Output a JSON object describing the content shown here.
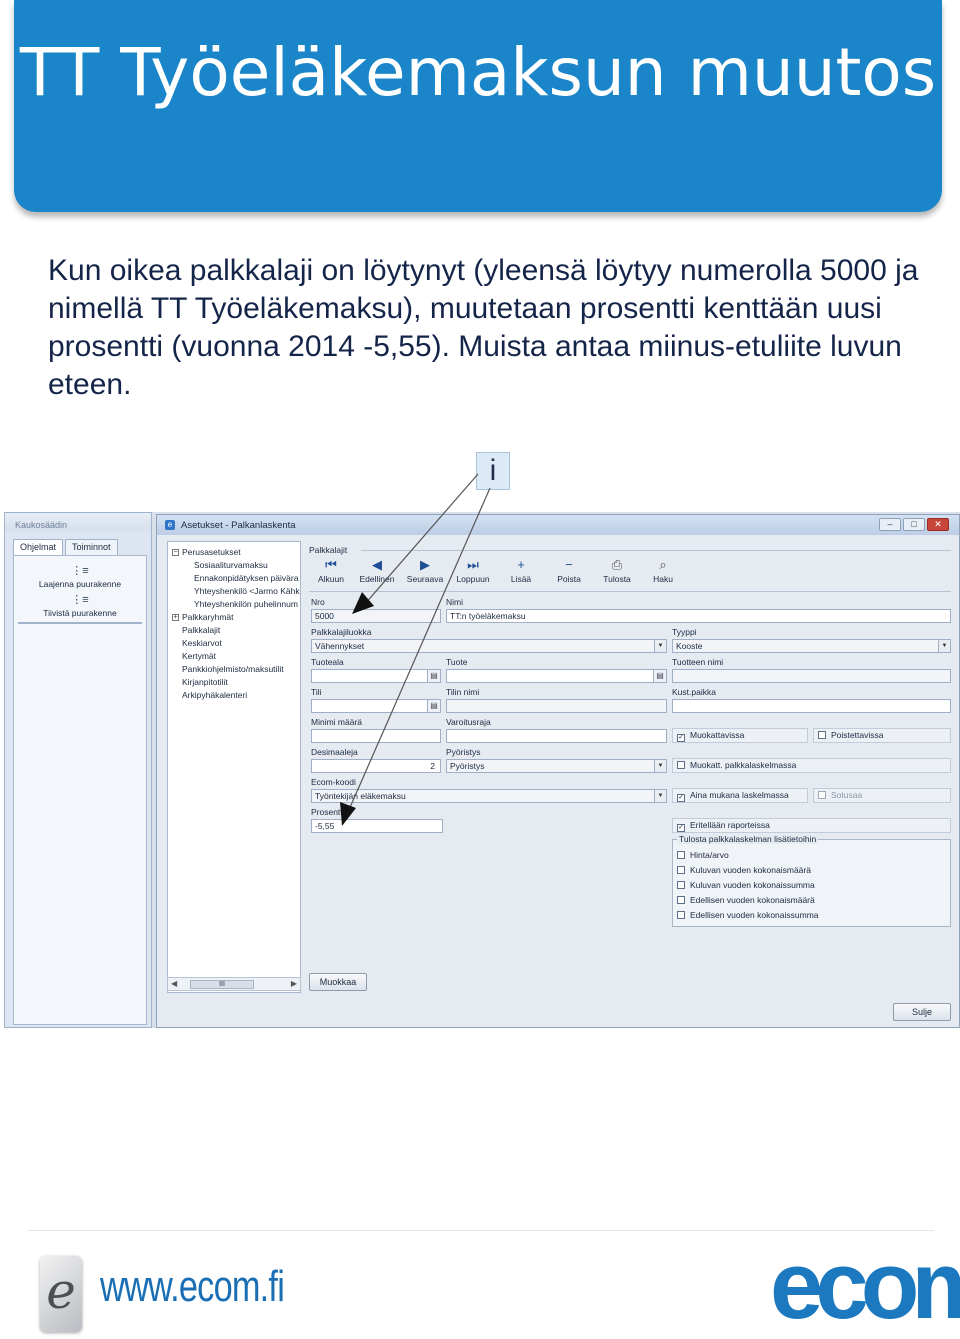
{
  "slide": {
    "title": "TT Työeläkemaksun muutos",
    "intro": "Kun oikea palkkalaji on löytynyt (yleensä löytyy numerolla 5000 ja nimellä TT Työeläkemaksu), muutetaan prosentti kenttään uusi prosentti (vuonna 2014 -5,55). Muista antaa miinus-etuliite luvun eteen.",
    "info_marker": "i",
    "footer_url": "www.ecom.fi",
    "footer_logo": "ecom",
    "footer_badge": "e",
    "accent_color": "#1a86c9"
  },
  "app": {
    "left_pane": {
      "title": "Kaukosäädin",
      "tabs": [
        "Ohjelmat",
        "Toiminnot"
      ],
      "items": [
        "Laajenna puurakenne",
        "Tiivistä puurakenne"
      ]
    },
    "window": {
      "title": "Asetukset - Palkanlaskenta",
      "controls": [
        "–",
        "□",
        "✕"
      ]
    },
    "tree": {
      "root": "Perusasetukset",
      "children": [
        "Sosiaaliturvamaksu",
        "Ennakonpidätyksen päivära",
        "Yhteyshenkilö <Jarmo Kähk",
        "Yhteyshenkilön puhelinnum"
      ],
      "items": [
        "Palkkaryhmät",
        "Palkkalajit",
        "Keskiarvot",
        "Kertymät",
        "Pankkiohjelmisto/maksutilit",
        "Kirjanpitotilit",
        "Arkipyhäkalenteri"
      ],
      "scroll_thumb": "III"
    },
    "buttons": {
      "edit": "Muokkaa",
      "close": "Sulje"
    },
    "toolbar": {
      "group_label": "Palkkalajit",
      "items": [
        {
          "label": "Alkuun",
          "icon": "first-icon",
          "glyph": "⏮"
        },
        {
          "label": "Edellinen",
          "icon": "previous-icon",
          "glyph": "◀"
        },
        {
          "label": "Seuraava",
          "icon": "next-icon",
          "glyph": "▶"
        },
        {
          "label": "Loppuun",
          "icon": "last-icon",
          "glyph": "⏭"
        },
        {
          "label": "Lisää",
          "icon": "add-icon",
          "glyph": "+"
        },
        {
          "label": "Poista",
          "icon": "remove-icon",
          "glyph": "−"
        },
        {
          "label": "Tulosta",
          "icon": "printer-icon",
          "glyph": "⎙"
        },
        {
          "label": "Haku",
          "icon": "search-icon",
          "glyph": "⌕"
        }
      ]
    },
    "form": {
      "nro": {
        "label": "Nro",
        "value": "5000"
      },
      "nimi": {
        "label": "Nimi",
        "value": "TT:n työeläkemaksu"
      },
      "palkkalajiluokka": {
        "label": "Palkkalajiluokka",
        "value": "Vähennykset"
      },
      "tyyppi": {
        "label": "Tyyppi",
        "value": "Kooste"
      },
      "tuoteala": {
        "label": "Tuoteala",
        "value": ""
      },
      "tuote": {
        "label": "Tuote",
        "value": ""
      },
      "tuotteen_nimi": {
        "label": "Tuotteen nimi",
        "value": ""
      },
      "tili": {
        "label": "Tili",
        "value": ""
      },
      "tilin_nimi": {
        "label": "Tilin nimi",
        "value": ""
      },
      "kust_paikka": {
        "label": "Kust.paikka",
        "value": ""
      },
      "minimi_maara": {
        "label": "Minimi määrä",
        "value": ""
      },
      "varoitusraja": {
        "label": "Varoitusraja",
        "value": ""
      },
      "desimaaleja": {
        "label": "Desimaaleja",
        "value": "2"
      },
      "pyoristys": {
        "label": "Pyöristys",
        "value": "Pyöristys"
      },
      "ecom_koodi": {
        "label": "Ecom-koodi",
        "value": "Työntekijän eläkemaksu"
      },
      "prosentti": {
        "label": "Prosentti",
        "value": "-5,55"
      }
    },
    "checks": {
      "muokattavissa": {
        "label": "Muokattavissa",
        "checked": true
      },
      "poistettavissa": {
        "label": "Poistettavissa",
        "checked": false
      },
      "muokatt_palkkalaskelmassa": {
        "label": "Muokatt. palkkalaskelmassa",
        "checked": false
      },
      "aina_mukana": {
        "label": "Aina mukana laskelmassa",
        "checked": true
      },
      "sotusaa": {
        "label": "Sotusaa",
        "checked": false
      },
      "eritellaan": {
        "label": "Eritellään raporteissa",
        "checked": true
      }
    },
    "print_group": {
      "legend": "Tulosta palkkalaskelman lisätietoihin",
      "options": [
        "Hinta/arvo",
        "Kuluvan vuoden kokonaismäärä",
        "Kuluvan vuoden kokonaissumma",
        "Edellisen vuoden kokonaismäärä",
        "Edellisen vuoden kokonaissumma"
      ]
    }
  }
}
